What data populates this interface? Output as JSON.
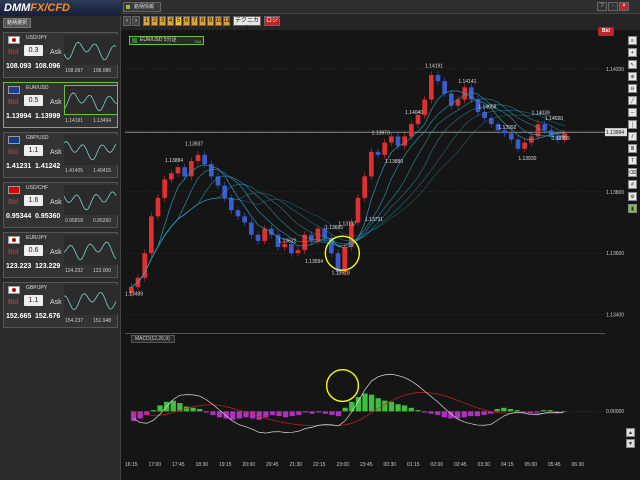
{
  "app": {
    "logo_left": "DMM",
    "logo_right": "FX/CFD",
    "pair_select_label": "銘柄選択",
    "tab_label": "銘柄情報"
  },
  "watchlist": [
    {
      "pair": "USD/JPY",
      "flag": "jp",
      "spread": "0.3",
      "bid_label": "Bid",
      "ask_label": "Ask",
      "bid": "108.093",
      "ask": "108.096",
      "low": "108.097",
      "high": "108.086",
      "active": false
    },
    {
      "pair": "EUR/USD",
      "flag": "eu",
      "spread": "0.5",
      "bid_label": "Bid",
      "ask_label": "Ask",
      "bid": "1.13994",
      "ask": "1.13999",
      "low": "1.14191",
      "high": "1.13494",
      "active": true
    },
    {
      "pair": "GBP/USD",
      "flag": "gb",
      "spread": "1.1",
      "bid_label": "Bid",
      "ask_label": "Ask",
      "bid": "1.41231",
      "ask": "1.41242",
      "low": "1.41405",
      "high": "1.40415",
      "active": false
    },
    {
      "pair": "USD/CHF",
      "flag": "ch",
      "spread": "1.6",
      "bid_label": "Bid",
      "ask_label": "Ask",
      "bid": "0.95344",
      "ask": "0.95360",
      "low": "0.95818",
      "high": "0.95260",
      "active": false
    },
    {
      "pair": "EUR/JPY",
      "flag": "jp",
      "spread": "0.6",
      "bid_label": "Bid",
      "ask_label": "Ask",
      "bid": "123.223",
      "ask": "123.229",
      "low": "124.232",
      "high": "123.000",
      "active": false
    },
    {
      "pair": "GBP/JPY",
      "flag": "jp",
      "spread": "1.1",
      "bid_label": "Bid",
      "ask_label": "Ask",
      "bid": "152.665",
      "ask": "152.676",
      "low": "154.237",
      "high": "151.948",
      "active": false
    }
  ],
  "toolbar": {
    "timeframes": [
      "1",
      "2",
      "3",
      "4",
      "5",
      "6",
      "7",
      "8",
      "9",
      "10",
      "11"
    ],
    "selected_timeframe": "5",
    "technical_label": "テクニカル",
    "style_label": "ロジ",
    "bid_label": "Bid",
    "window_buttons": [
      "?",
      "-",
      "×"
    ]
  },
  "chart_label": "EUR/USD 5分足",
  "chart_label_tag": "Bid",
  "macd_label": "MACD(12,26,9)",
  "chart_data": {
    "type": "candlestick",
    "price_axis": {
      "ticks": [
        "1.14200",
        "1.14000",
        "1.13800",
        "1.13600",
        "1.13400"
      ],
      "ylim": [
        1.1335,
        1.1432
      ]
    },
    "current_price": "1.13994",
    "macd_axis": {
      "ticks": [
        "0.00000"
      ]
    },
    "time_axis": [
      "16:15",
      "17:00",
      "17:45",
      "18:30",
      "19:15",
      "20:00",
      "20:45",
      "21:30",
      "22:15",
      "23:00",
      "23:45",
      "00:30",
      "01:15",
      "02:00",
      "02:45",
      "03:30",
      "04:15",
      "05:00",
      "05:45",
      "06:30"
    ],
    "annotations": [
      "1.13489",
      "1.13884",
      "1.13937",
      "1.13622",
      "1.13594",
      "1.13665",
      "1.13717",
      "1.13518",
      "1.13973",
      "1.14040",
      "1.13731",
      "1.13880",
      "1.14191",
      "1.14141",
      "1.14058",
      "1.13992",
      "1.13930",
      "1.14039",
      "1.14020",
      "1.13955"
    ],
    "closes": [
      1.1349,
      1.1352,
      1.136,
      1.1372,
      1.1378,
      1.1384,
      1.1386,
      1.1388,
      1.1385,
      1.139,
      1.1392,
      1.1389,
      1.1385,
      1.1382,
      1.1378,
      1.1374,
      1.1372,
      1.137,
      1.1366,
      1.1364,
      1.1368,
      1.1366,
      1.1362,
      1.1363,
      1.136,
      1.1361,
      1.1366,
      1.1364,
      1.1368,
      1.1365,
      1.136,
      1.1354,
      1.1362,
      1.137,
      1.1378,
      1.1385,
      1.1393,
      1.1392,
      1.1396,
      1.1398,
      1.1395,
      1.1398,
      1.1402,
      1.1405,
      1.141,
      1.1418,
      1.1416,
      1.1412,
      1.1408,
      1.141,
      1.1414,
      1.141,
      1.1406,
      1.1404,
      1.1402,
      1.14,
      1.1399,
      1.1397,
      1.1394,
      1.1396,
      1.1398,
      1.1402,
      1.14,
      1.1398,
      1.1397,
      1.1399
    ],
    "macd_hist": [
      -0.8,
      -0.6,
      -0.3,
      0.1,
      0.5,
      0.8,
      0.9,
      0.7,
      0.4,
      0.3,
      0.2,
      -0.1,
      -0.3,
      -0.5,
      -0.6,
      -0.7,
      -0.6,
      -0.5,
      -0.6,
      -0.7,
      -0.5,
      -0.3,
      -0.4,
      -0.5,
      -0.4,
      -0.3,
      -0.1,
      -0.2,
      -0.1,
      -0.2,
      -0.3,
      -0.4,
      0.3,
      0.8,
      1.2,
      1.5,
      1.4,
      1.1,
      0.9,
      0.8,
      0.6,
      0.5,
      0.3,
      0.1,
      -0.1,
      -0.2,
      -0.3,
      -0.5,
      -0.6,
      -0.6,
      -0.5,
      -0.4,
      -0.4,
      -0.3,
      -0.2,
      0.2,
      0.3,
      0.2,
      0.1,
      -0.1,
      -0.2,
      -0.1,
      0.1,
      0.1,
      -0.1,
      0.0
    ],
    "colors": {
      "bull": "#e03030",
      "bear": "#3a5cd0",
      "ma": "#2aa8c8",
      "macd": "#e0e0e0",
      "signal": "#d02020",
      "hist_pos": "#3fbf3f",
      "hist_neg": "#b030c0"
    }
  }
}
